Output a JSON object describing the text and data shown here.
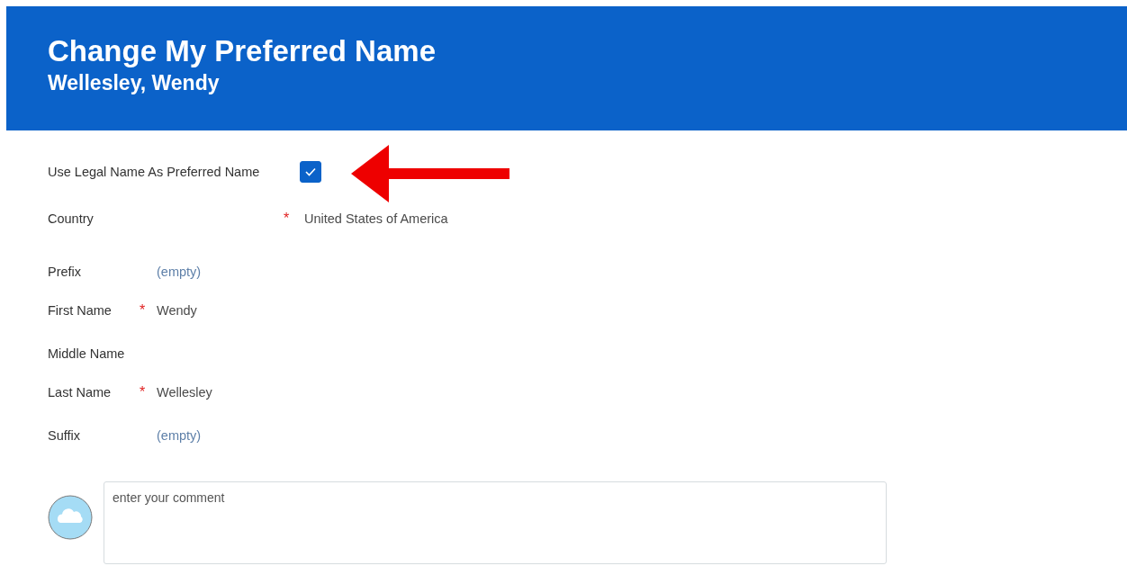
{
  "header": {
    "title": "Change My Preferred Name",
    "subtitle": "Wellesley, Wendy"
  },
  "legal_name_option": {
    "label": "Use Legal Name As Preferred Name",
    "checked": true
  },
  "fields": [
    {
      "kind": "wide",
      "label": "Country",
      "required_mark": "*",
      "value": "United States of America",
      "empty": false
    },
    {
      "kind": "narrow",
      "label": "Prefix",
      "value": "(empty)",
      "empty": true
    },
    {
      "kind": "narrow",
      "label": "First Name",
      "required_mark": "*",
      "value": "Wendy",
      "empty": false
    },
    {
      "kind": "narrow",
      "label": "Middle Name"
    },
    {
      "kind": "narrow",
      "label": "Last Name",
      "required_mark": "*",
      "value": "Wellesley",
      "empty": false
    },
    {
      "kind": "narrow",
      "label": "Suffix",
      "value": "(empty)",
      "empty": true
    }
  ],
  "comment": {
    "placeholder": "enter your comment"
  }
}
